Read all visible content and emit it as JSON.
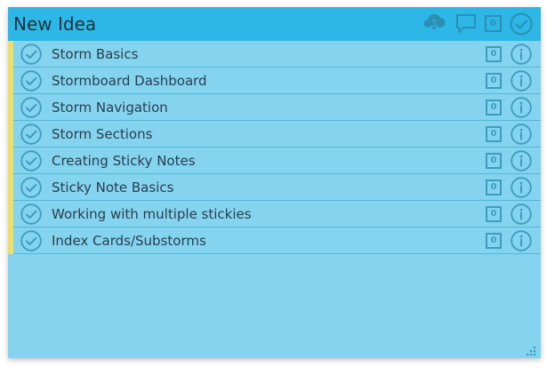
{
  "header": {
    "title": "New Idea",
    "comment_count": "0",
    "icons": [
      "cloud-download-icon",
      "comment-icon",
      "check-circle-icon"
    ]
  },
  "items": [
    {
      "label": "Storm Basics",
      "count": "0"
    },
    {
      "label": "Stormboard Dashboard",
      "count": "0"
    },
    {
      "label": "Storm Navigation",
      "count": "0"
    },
    {
      "label": "Storm Sections",
      "count": "0"
    },
    {
      "label": "Creating Sticky Notes",
      "count": "0"
    },
    {
      "label": "Sticky Note Basics",
      "count": "0"
    },
    {
      "label": "Working with multiple stickies",
      "count": "0"
    },
    {
      "label": "Index Cards/Substorms",
      "count": "0"
    }
  ],
  "colors": {
    "header": "#2db7e6",
    "body": "#84d3ef",
    "accent_bar": "#eedf68",
    "icon": "#2b8fb4"
  }
}
